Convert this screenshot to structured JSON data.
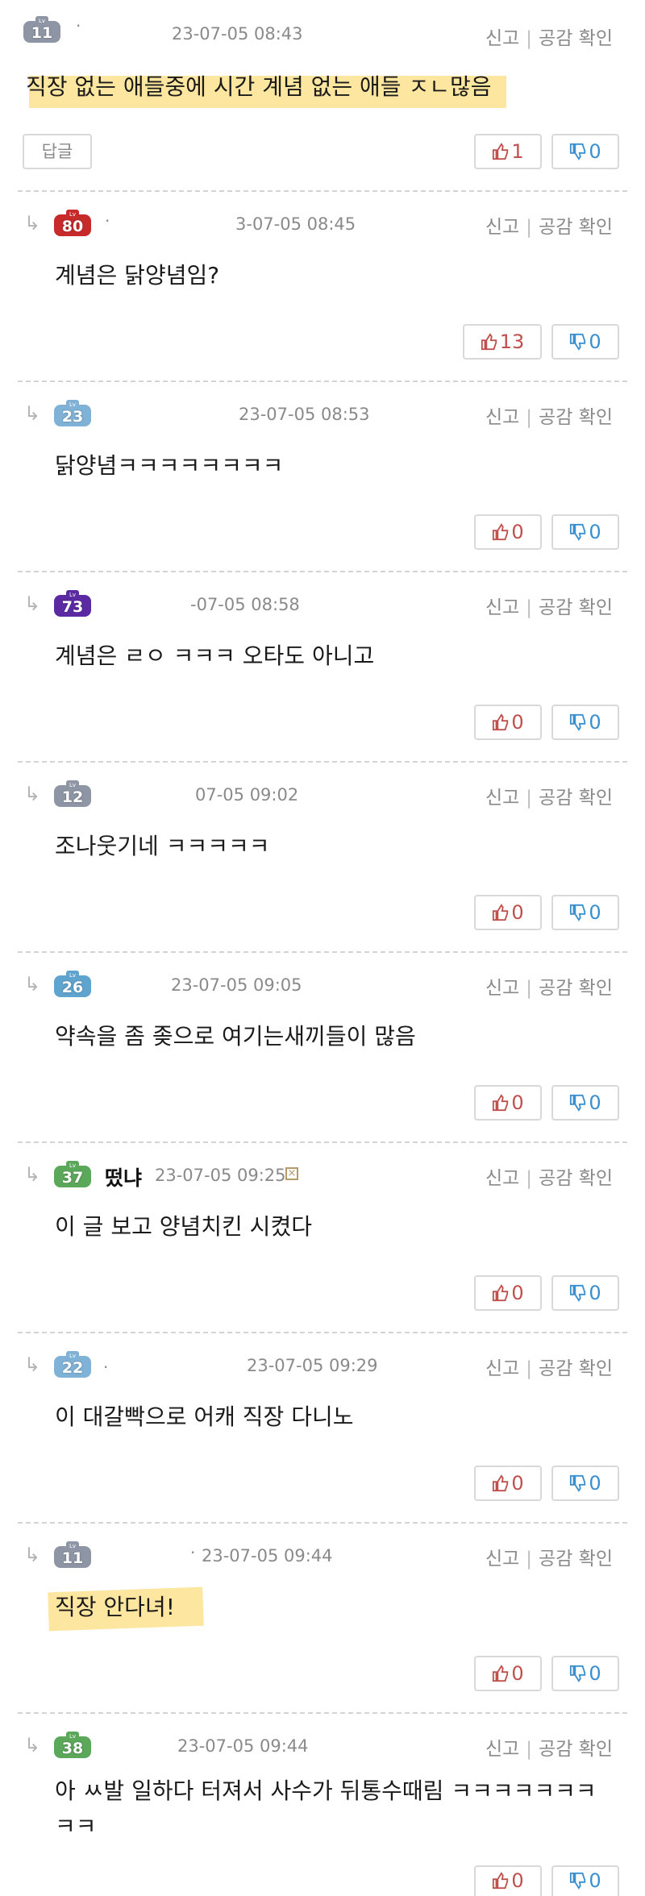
{
  "actions": {
    "report": "신고",
    "likes": "공감 확인"
  },
  "reply_button": "답글",
  "comments": [
    {
      "level": "11",
      "level_color": "#8e95a4",
      "nickname": "",
      "date": "23-07-05 08:43",
      "content": "직장 없는 애들중에 시간 계념 없는 애들 ㅈㄴ많음",
      "up": "1",
      "down": "0"
    },
    {
      "level": "80",
      "level_color": "#c72a2a",
      "nickname": "",
      "date": "3-07-05 08:45",
      "content": "계념은 닭양념임?",
      "up": "13",
      "down": "0"
    },
    {
      "level": "23",
      "level_color": "#7fb2d6",
      "nickname": "",
      "date": "23-07-05 08:53",
      "content": "닭양념ㅋㅋㅋㅋㅋㅋㅋㅋ",
      "up": "0",
      "down": "0"
    },
    {
      "level": "73",
      "level_color": "#5b2aa3",
      "nickname": "",
      "date": "-07-05 08:58",
      "content": "계념은 ㄹㅇ ㅋㅋㅋ 오타도 아니고",
      "up": "0",
      "down": "0"
    },
    {
      "level": "12",
      "level_color": "#8e95a4",
      "nickname": "",
      "date": "07-05 09:02",
      "content": "조나웃기네 ㅋㅋㅋㅋㅋ",
      "up": "0",
      "down": "0"
    },
    {
      "level": "26",
      "level_color": "#5fa3cf",
      "nickname": "",
      "date": "23-07-05 09:05",
      "content": "약속을 좀 좆으로 여기는새끼들이 많음",
      "up": "0",
      "down": "0"
    },
    {
      "level": "37",
      "level_color": "#5ba85a",
      "nickname": "떴냐",
      "date": "23-07-05 09:25",
      "content": "이 글 보고 양념치킨 시켰다",
      "up": "0",
      "down": "0"
    },
    {
      "level": "22",
      "level_color": "#7fb2d6",
      "nickname": "",
      "date": "23-07-05 09:29",
      "content": "이 대갈빡으로 어캐 직장 다니노",
      "up": "0",
      "down": "0"
    },
    {
      "level": "11",
      "level_color": "#8e95a4",
      "nickname": "",
      "date": "23-07-05 09:44",
      "content": "직장 안다녀!",
      "up": "0",
      "down": "0"
    },
    {
      "level": "38",
      "level_color": "#5ba85a",
      "nickname": "",
      "date": "23-07-05 09:44",
      "content": "아 ㅆ발 일하다 터져서 사수가 뒤통수때림 ㅋㅋㅋㅋㅋㅋㅋ ㅋㅋ",
      "up": "0",
      "down": "0"
    }
  ],
  "icons": {
    "reply": "reply-arrow-icon",
    "thumb_up": "thumb-up-icon",
    "thumb_down": "thumb-down-icon"
  }
}
